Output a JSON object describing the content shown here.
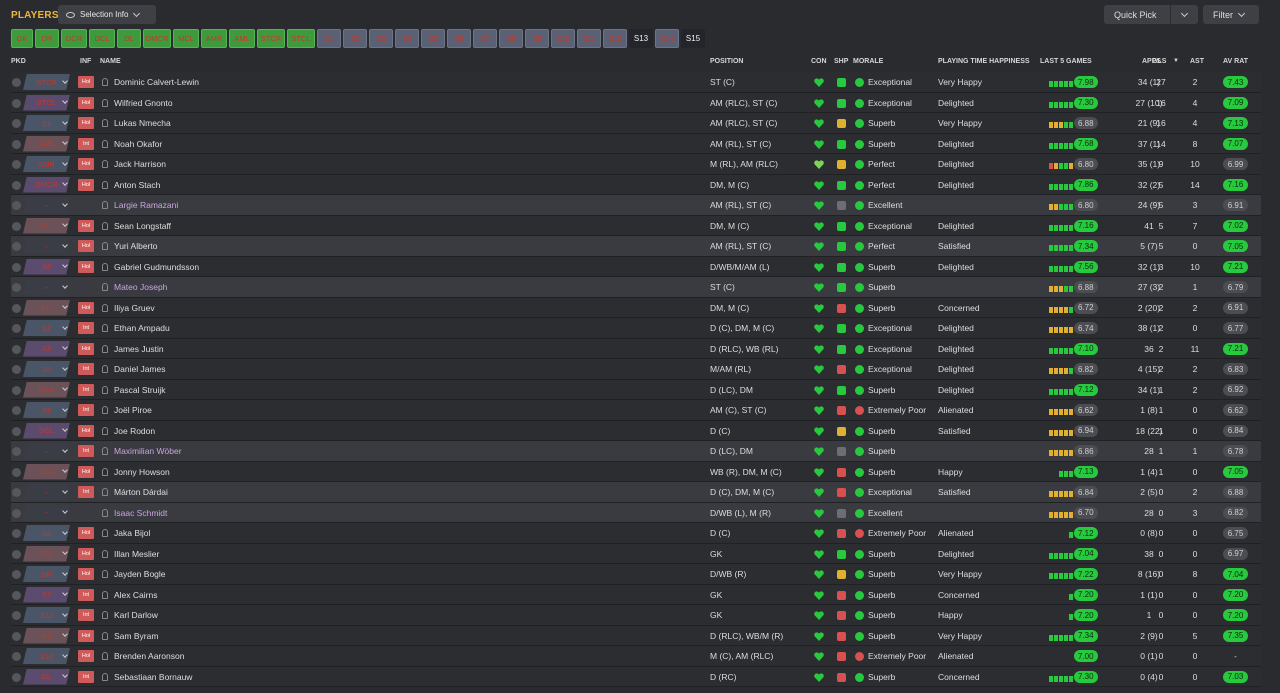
{
  "header": {
    "title": "PLAYERS",
    "selection_info": "Selection Info",
    "quick_pick": "Quick Pick",
    "filter": "Filter"
  },
  "tabs": [
    {
      "label": "GK",
      "style": "g"
    },
    {
      "label": "DR",
      "style": "g"
    },
    {
      "label": "DCR",
      "style": "g"
    },
    {
      "label": "DCL",
      "style": "g"
    },
    {
      "label": "DL",
      "style": "g"
    },
    {
      "label": "DMCR",
      "style": "g"
    },
    {
      "label": "MCL",
      "style": "g"
    },
    {
      "label": "AMR",
      "style": "g"
    },
    {
      "label": "AML",
      "style": "g"
    },
    {
      "label": "STCR",
      "style": "g"
    },
    {
      "label": "STCL",
      "style": "g"
    },
    {
      "label": "S1",
      "style": "s"
    },
    {
      "label": "S2",
      "style": "s"
    },
    {
      "label": "S3",
      "style": "s"
    },
    {
      "label": "S4",
      "style": "s"
    },
    {
      "label": "S5",
      "style": "s"
    },
    {
      "label": "S6",
      "style": "s"
    },
    {
      "label": "S7",
      "style": "s"
    },
    {
      "label": "S8",
      "style": "s"
    },
    {
      "label": "S9",
      "style": "s"
    },
    {
      "label": "S10",
      "style": "s"
    },
    {
      "label": "S11",
      "style": "s"
    },
    {
      "label": "S12",
      "style": "s"
    },
    {
      "label": "S13",
      "style": "sel"
    },
    {
      "label": "S14",
      "style": "s"
    },
    {
      "label": "S15",
      "style": "sel"
    }
  ],
  "columns": {
    "pkd": "PKD",
    "inf": "INF",
    "name": "NAME",
    "position": "POSITION",
    "con": "CON",
    "shp": "SHP",
    "morale": "MORALE",
    "pth": "PLAYING TIME HAPPINESS",
    "l5": "LAST 5 GAMES",
    "apps": "APPS",
    "gls": "GLS",
    "ast": "AST",
    "avrat": "AV RAT"
  },
  "colors": {
    "green": "#27c93f",
    "yellow": "#e0b030",
    "red": "#d95050",
    "lightgreen": "#7fd35a",
    "rating_bg": "#3d9b3d",
    "neutral": "#4b4d52"
  },
  "rows": [
    {
      "pkd": "STCR",
      "inf": "Hol",
      "name": "Dominic Calvert-Lewin",
      "pos": "ST (C)",
      "morale": "Exceptional",
      "mc": "g",
      "pth": "Very Happy",
      "l5": [
        1,
        1,
        1,
        1,
        1
      ],
      "l5r": "7.98",
      "apps": "34 (1)",
      "gls": "27",
      "ast": "2",
      "av": "7.43",
      "avc": "g",
      "shp": "g",
      "con": "g"
    },
    {
      "pkd": "STCL",
      "inf": "Hol",
      "name": "Wilfried Gnonto",
      "pos": "AM (RLC), ST (C)",
      "morale": "Exceptional",
      "mc": "g",
      "pth": "Delighted",
      "l5": [
        1,
        1,
        1,
        1,
        1
      ],
      "l5r": "7.30",
      "apps": "27 (10)",
      "gls": "16",
      "ast": "4",
      "av": "7.09",
      "avc": "g",
      "shp": "g",
      "con": "g"
    },
    {
      "pkd": "S1",
      "inf": "Hol",
      "name": "Lukas Nmecha",
      "pos": "AM (RLC), ST (C)",
      "morale": "Superb",
      "mc": "g",
      "pth": "Very Happy",
      "l5": [
        2,
        2,
        2,
        1,
        1
      ],
      "l5r": "6.88",
      "apps": "21 (9)",
      "gls": "16",
      "ast": "4",
      "av": "7.13",
      "avc": "g",
      "shp": "y",
      "con": "g"
    },
    {
      "pkd": "AML",
      "inf": "Int",
      "name": "Noah Okafor",
      "pos": "AM (RL), ST (C)",
      "morale": "Superb",
      "mc": "g",
      "pth": "Delighted",
      "l5": [
        1,
        1,
        1,
        1,
        1
      ],
      "l5r": "7.68",
      "apps": "37 (1)",
      "gls": "14",
      "ast": "8",
      "av": "7.07",
      "avc": "g",
      "shp": "g",
      "con": "g"
    },
    {
      "pkd": "AMR",
      "inf": "Hol",
      "name": "Jack Harrison",
      "pos": "M (RL), AM (RLC)",
      "morale": "Perfect",
      "mc": "g",
      "pth": "Delighted",
      "l5": [
        3,
        2,
        1,
        1,
        2
      ],
      "l5r": "6.80",
      "apps": "35 (1)",
      "gls": "9",
      "ast": "10",
      "av": "6.99",
      "avc": "n",
      "shp": "y",
      "con": "y"
    },
    {
      "pkd": "DMCR",
      "inf": "Hol",
      "name": "Anton Stach",
      "pos": "DM, M (C)",
      "morale": "Perfect",
      "mc": "g",
      "pth": "Delighted",
      "l5": [
        1,
        1,
        1,
        1,
        1
      ],
      "l5r": "7.86",
      "apps": "32 (2)",
      "gls": "5",
      "ast": "14",
      "av": "7.16",
      "avc": "g",
      "shp": "g",
      "con": "g"
    },
    {
      "pkd": "-",
      "inf": "",
      "name": "Largie Ramazani",
      "pos": "AM (RL), ST (C)",
      "morale": "Excellent",
      "mc": "g",
      "pth": "",
      "l5": [
        2,
        2,
        1,
        1,
        1
      ],
      "l5r": "6.80",
      "apps": "24 (9)",
      "gls": "5",
      "ast": "3",
      "av": "6.91",
      "avc": "n",
      "shp": "n",
      "con": "g",
      "loan": true,
      "hl": true
    },
    {
      "pkd": "MCL",
      "inf": "Hol",
      "name": "Sean Longstaff",
      "pos": "DM, M (C)",
      "morale": "Exceptional",
      "mc": "g",
      "pth": "Delighted",
      "l5": [
        1,
        1,
        1,
        1,
        1
      ],
      "l5r": "7.16",
      "apps": "41",
      "gls": "5",
      "ast": "7",
      "av": "7.02",
      "avc": "g",
      "shp": "g",
      "con": "g"
    },
    {
      "pkd": "-",
      "inf": "Hol",
      "name": "Yuri Alberto",
      "pos": "AM (RL), ST (C)",
      "morale": "Perfect",
      "mc": "g",
      "pth": "Satisfied",
      "l5": [
        1,
        1,
        1,
        1,
        1
      ],
      "l5r": "7.34",
      "apps": "5 (7)",
      "gls": "5",
      "ast": "0",
      "av": "7.05",
      "avc": "g",
      "shp": "g",
      "con": "g",
      "hl": true
    },
    {
      "pkd": "S8",
      "inf": "Hol",
      "name": "Gabriel Gudmundsson",
      "pos": "D/WB/M/AM (L)",
      "morale": "Superb",
      "mc": "g",
      "pth": "Delighted",
      "l5": [
        1,
        1,
        1,
        1,
        1
      ],
      "l5r": "7.56",
      "apps": "32 (1)",
      "gls": "3",
      "ast": "10",
      "av": "7.21",
      "avc": "g",
      "shp": "g",
      "con": "g"
    },
    {
      "pkd": "-",
      "inf": "",
      "name": "Mateo Joseph",
      "pos": "ST (C)",
      "morale": "Superb",
      "mc": "g",
      "pth": "",
      "l5": [
        2,
        2,
        2,
        1,
        1
      ],
      "l5r": "6.88",
      "apps": "27 (3)",
      "gls": "2",
      "ast": "1",
      "av": "6.79",
      "avc": "n",
      "shp": "g",
      "con": "g",
      "loan": true,
      "hl": true
    },
    {
      "pkd": "S11",
      "inf": "Hol",
      "name": "Iliya Gruev",
      "pos": "DM, M (C)",
      "morale": "Superb",
      "mc": "g",
      "pth": "Concerned",
      "l5": [
        2,
        2,
        2,
        2,
        1
      ],
      "l5r": "6.72",
      "apps": "2 (20)",
      "gls": "2",
      "ast": "2",
      "av": "6.91",
      "avc": "n",
      "shp": "r",
      "con": "g"
    },
    {
      "pkd": "S2",
      "inf": "Int",
      "name": "Ethan Ampadu",
      "pos": "D (C), DM, M (C)",
      "morale": "Exceptional",
      "mc": "g",
      "pth": "Delighted",
      "l5": [
        2,
        2,
        2,
        2,
        2
      ],
      "l5r": "6.74",
      "apps": "38 (1)",
      "gls": "2",
      "ast": "0",
      "av": "6.77",
      "avc": "n",
      "shp": "g",
      "con": "g"
    },
    {
      "pkd": "S3",
      "inf": "Hol",
      "name": "James Justin",
      "pos": "D (RLC), WB (RL)",
      "morale": "Exceptional",
      "mc": "g",
      "pth": "Delighted",
      "l5": [
        1,
        1,
        1,
        1,
        1
      ],
      "l5r": "7.10",
      "apps": "36",
      "gls": "2",
      "ast": "11",
      "av": "7.21",
      "avc": "g",
      "shp": "g",
      "con": "g"
    },
    {
      "pkd": "S5",
      "inf": "Int",
      "name": "Daniel James",
      "pos": "M/AM (RL)",
      "morale": "Exceptional",
      "mc": "g",
      "pth": "Delighted",
      "l5": [
        2,
        2,
        2,
        2,
        1
      ],
      "l5r": "6.82",
      "apps": "4 (15)",
      "gls": "2",
      "ast": "2",
      "av": "6.83",
      "avc": "n",
      "shp": "r",
      "con": "g"
    },
    {
      "pkd": "DCR",
      "inf": "Int",
      "name": "Pascal Struijk",
      "pos": "D (LC), DM",
      "morale": "Superb",
      "mc": "g",
      "pth": "Delighted",
      "l5": [
        1,
        1,
        1,
        1,
        1
      ],
      "l5r": "7.12",
      "apps": "34 (1)",
      "gls": "1",
      "ast": "2",
      "av": "6.92",
      "avc": "n",
      "shp": "g",
      "con": "g"
    },
    {
      "pkd": "S9",
      "inf": "Int",
      "name": "Joël Piroe",
      "pos": "AM (C), ST (C)",
      "morale": "Extremely Poor",
      "mc": "r",
      "pth": "Alienated",
      "l5": [
        2,
        2,
        2,
        2,
        2
      ],
      "l5r": "6.62",
      "apps": "1 (8)",
      "gls": "1",
      "ast": "0",
      "av": "6.62",
      "avc": "n",
      "shp": "r",
      "con": "g"
    },
    {
      "pkd": "DCL",
      "inf": "Hol",
      "name": "Joe Rodon",
      "pos": "D (C)",
      "morale": "Superb",
      "mc": "g",
      "pth": "Satisfied",
      "l5": [
        2,
        2,
        2,
        2,
        2
      ],
      "l5r": "6.94",
      "apps": "18 (22)",
      "gls": "1",
      "ast": "0",
      "av": "6.84",
      "avc": "n",
      "shp": "y",
      "con": "g"
    },
    {
      "pkd": "-",
      "inf": "Int",
      "name": "Maximilian Wöber",
      "pos": "D (LC), DM",
      "morale": "Superb",
      "mc": "g",
      "pth": "",
      "l5": [
        2,
        2,
        2,
        2,
        2
      ],
      "l5r": "6.86",
      "apps": "28",
      "gls": "1",
      "ast": "1",
      "av": "6.78",
      "avc": "n",
      "shp": "n",
      "con": "g",
      "loan": true,
      "hl": true
    },
    {
      "pkd": "S14",
      "inf": "Hol",
      "name": "Jonny Howson",
      "pos": "WB (R), DM, M (C)",
      "morale": "Superb",
      "mc": "g",
      "pth": "Happy",
      "l5": [
        1,
        1,
        1
      ],
      "l5r": "7.13",
      "apps": "1 (4)",
      "gls": "1",
      "ast": "0",
      "av": "7.05",
      "avc": "g",
      "shp": "r",
      "con": "g"
    },
    {
      "pkd": "-",
      "inf": "Int",
      "name": "Márton Dárdai",
      "pos": "D (C), DM, M (C)",
      "morale": "Exceptional",
      "mc": "g",
      "pth": "Satisfied",
      "l5": [
        2,
        2,
        2,
        2,
        2
      ],
      "l5r": "6.84",
      "apps": "2 (5)",
      "gls": "0",
      "ast": "2",
      "av": "6.88",
      "avc": "n",
      "shp": "r",
      "con": "g",
      "hl": true
    },
    {
      "pkd": "-",
      "inf": "",
      "name": "Isaac Schmidt",
      "pos": "D/WB (L), M (R)",
      "morale": "Excellent",
      "mc": "g",
      "pth": "",
      "l5": [
        2,
        2,
        2,
        2,
        2
      ],
      "l5r": "6.70",
      "apps": "28",
      "gls": "0",
      "ast": "3",
      "av": "6.82",
      "avc": "n",
      "shp": "n",
      "con": "g",
      "loan": true,
      "hl": true
    },
    {
      "pkd": "S6",
      "inf": "Hol",
      "name": "Jaka Bijol",
      "pos": "D (C)",
      "morale": "Extremely Poor",
      "mc": "r",
      "pth": "Alienated",
      "l5": [
        1
      ],
      "l5r": "7.12",
      "apps": "0 (8)",
      "gls": "0",
      "ast": "0",
      "av": "6.75",
      "avc": "n",
      "shp": "r",
      "con": "g"
    },
    {
      "pkd": "GK",
      "inf": "Hol",
      "name": "Illan Meslier",
      "pos": "GK",
      "morale": "Superb",
      "mc": "g",
      "pth": "Delighted",
      "l5": [
        1,
        1,
        1,
        1,
        1
      ],
      "l5r": "7.04",
      "apps": "38",
      "gls": "0",
      "ast": "0",
      "av": "6.97",
      "avc": "n",
      "shp": "g",
      "con": "g"
    },
    {
      "pkd": "DR",
      "inf": "Hol",
      "name": "Jayden Bogle",
      "pos": "D/WB (R)",
      "morale": "Superb",
      "mc": "g",
      "pth": "Very Happy",
      "l5": [
        1,
        1,
        1,
        1,
        1
      ],
      "l5r": "7.22",
      "apps": "8 (16)",
      "gls": "0",
      "ast": "8",
      "av": "7.04",
      "avc": "g",
      "shp": "y",
      "con": "g"
    },
    {
      "pkd": "S7",
      "inf": "Int",
      "name": "Alex Cairns",
      "pos": "GK",
      "morale": "Superb",
      "mc": "g",
      "pth": "Concerned",
      "l5": [
        1
      ],
      "l5r": "7.20",
      "apps": "1 (1)",
      "gls": "0",
      "ast": "0",
      "av": "7.20",
      "avc": "g",
      "shp": "r",
      "con": "g"
    },
    {
      "pkd": "S12",
      "inf": "Int",
      "name": "Karl Darlow",
      "pos": "GK",
      "morale": "Superb",
      "mc": "g",
      "pth": "Happy",
      "l5": [
        1
      ],
      "l5r": "7.20",
      "apps": "1",
      "gls": "0",
      "ast": "0",
      "av": "7.20",
      "avc": "g",
      "shp": "r",
      "con": "g"
    },
    {
      "pkd": "S4",
      "inf": "Hol",
      "name": "Sam Byram",
      "pos": "D (RLC), WB/M (R)",
      "morale": "Superb",
      "mc": "g",
      "pth": "Very Happy",
      "l5": [
        1,
        1,
        1,
        1,
        1
      ],
      "l5r": "7.34",
      "apps": "2 (9)",
      "gls": "0",
      "ast": "5",
      "av": "7.35",
      "avc": "g",
      "shp": "r",
      "con": "g"
    },
    {
      "pkd": "S10",
      "inf": "Hol",
      "name": "Brenden Aaronson",
      "pos": "M (C), AM (RLC)",
      "morale": "Extremely Poor",
      "mc": "r",
      "pth": "Alienated",
      "l5": [],
      "l5r": "7.00",
      "apps": "0 (1)",
      "gls": "0",
      "ast": "0",
      "av": "-",
      "avc": "x",
      "shp": "r",
      "con": "g"
    },
    {
      "pkd": "DL",
      "inf": "Int",
      "name": "Sebastiaan Bornauw",
      "pos": "D (RC)",
      "morale": "Superb",
      "mc": "g",
      "pth": "Concerned",
      "l5": [
        1,
        1,
        1,
        1,
        1
      ],
      "l5r": "7.30",
      "apps": "0 (4)",
      "gls": "0",
      "ast": "0",
      "av": "7.03",
      "avc": "g",
      "shp": "r",
      "con": "g"
    }
  ]
}
